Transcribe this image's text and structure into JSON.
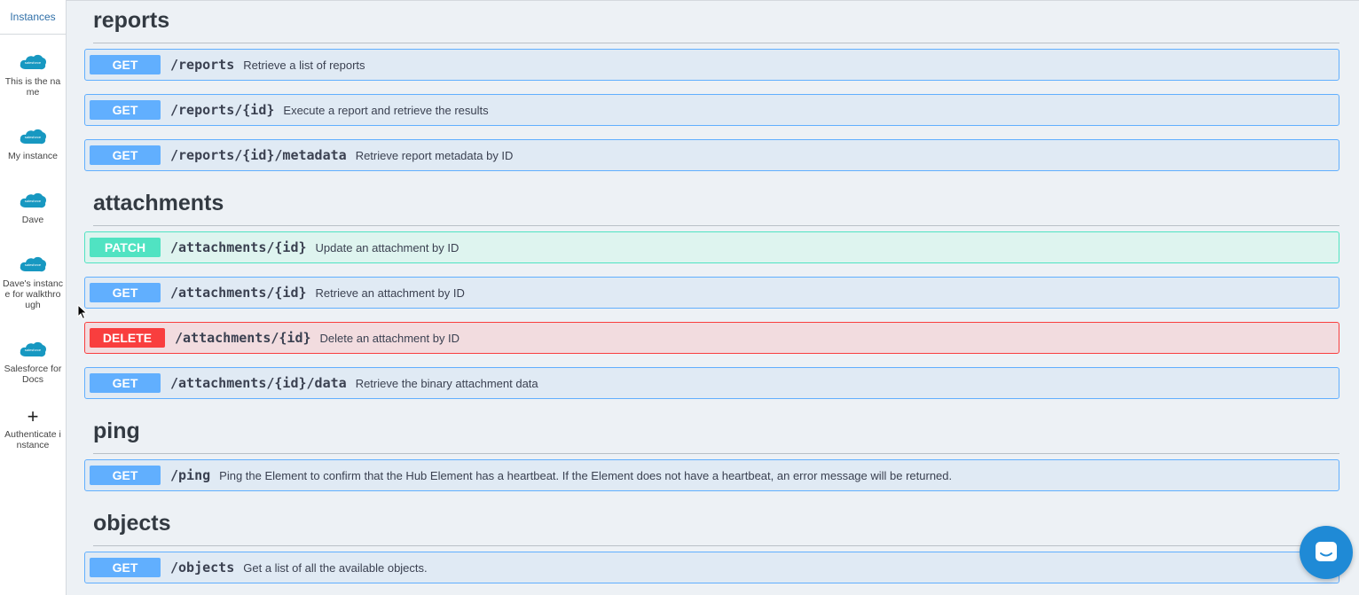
{
  "sidebar": {
    "title": "Instances",
    "instances": [
      {
        "label": "This is the name",
        "icon": "salesforce-cloud-icon"
      },
      {
        "label": "My instance",
        "icon": "salesforce-cloud-icon"
      },
      {
        "label": "Dave",
        "icon": "salesforce-cloud-icon"
      },
      {
        "label": "Dave's instance for walkthrough",
        "icon": "salesforce-cloud-icon"
      },
      {
        "label": "Salesforce for Docs",
        "icon": "salesforce-cloud-icon"
      }
    ],
    "add_label": "Authenticate instance",
    "cloud_text": "salesforce"
  },
  "sections": [
    {
      "title": "reports",
      "operations": [
        {
          "method": "GET",
          "path": "/reports",
          "description": "Retrieve a list of reports"
        },
        {
          "method": "GET",
          "path": "/reports/{id}",
          "description": "Execute a report and retrieve the results"
        },
        {
          "method": "GET",
          "path": "/reports/{id}/metadata",
          "description": "Retrieve report metadata by ID"
        }
      ]
    },
    {
      "title": "attachments",
      "operations": [
        {
          "method": "PATCH",
          "path": "/attachments/{id}",
          "description": "Update an attachment by ID"
        },
        {
          "method": "GET",
          "path": "/attachments/{id}",
          "description": "Retrieve an attachment by ID"
        },
        {
          "method": "DELETE",
          "path": "/attachments/{id}",
          "description": "Delete an attachment by ID"
        },
        {
          "method": "GET",
          "path": "/attachments/{id}/data",
          "description": "Retrieve the binary attachment data"
        }
      ]
    },
    {
      "title": "ping",
      "operations": [
        {
          "method": "GET",
          "path": "/ping",
          "description": "Ping the Element to confirm that the Hub Element has a heartbeat. If the Element does not have a heartbeat, an error message will be returned."
        }
      ]
    },
    {
      "title": "objects",
      "operations": [
        {
          "method": "GET",
          "path": "/objects",
          "description": "Get a list of all the available objects."
        }
      ]
    }
  ],
  "colors": {
    "get": "#61affe",
    "patch": "#50e3c2",
    "delete": "#f93e3e",
    "sidebar_accent": "#2f6fa8",
    "chat": "#1f8ad6"
  }
}
